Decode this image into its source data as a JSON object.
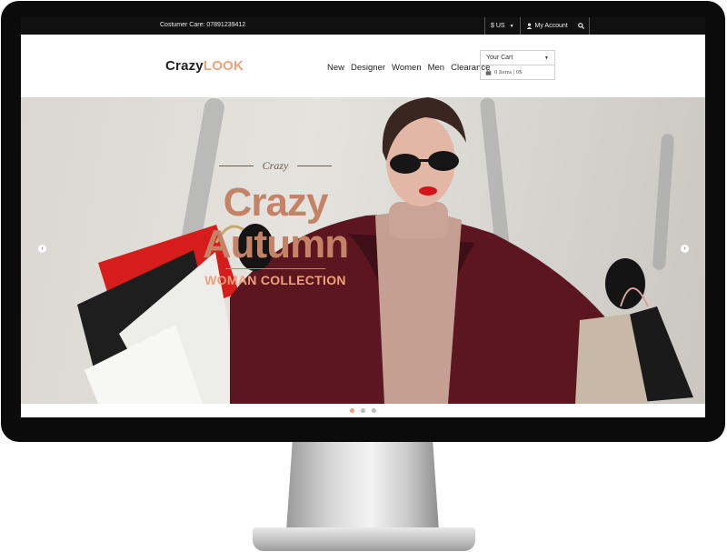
{
  "topbar": {
    "care_text": "Costumer Care: 07891239412",
    "currency": "$ US",
    "account": "My Account"
  },
  "header": {
    "logo_part1": "Crazy",
    "logo_part2": "LOOK",
    "nav": [
      "New",
      "Designer",
      "Women",
      "Men",
      "Clearance"
    ],
    "cart_select": "Your Cart",
    "cart_info": "0 Items | 0$"
  },
  "hero": {
    "small_title": "Crazy",
    "big_line1": "Crazy",
    "big_line2": "Autumn",
    "collection": "WOMAN COLLECTION",
    "slide_index": 1,
    "slide_count": 3
  },
  "colors": {
    "accent": "#f0a07c",
    "title": "#c48366",
    "coat": "#5b1620"
  },
  "icons": [
    "caret-down-icon",
    "user-icon",
    "search-icon",
    "bag-icon",
    "arrow-left-icon",
    "arrow-right-icon"
  ]
}
